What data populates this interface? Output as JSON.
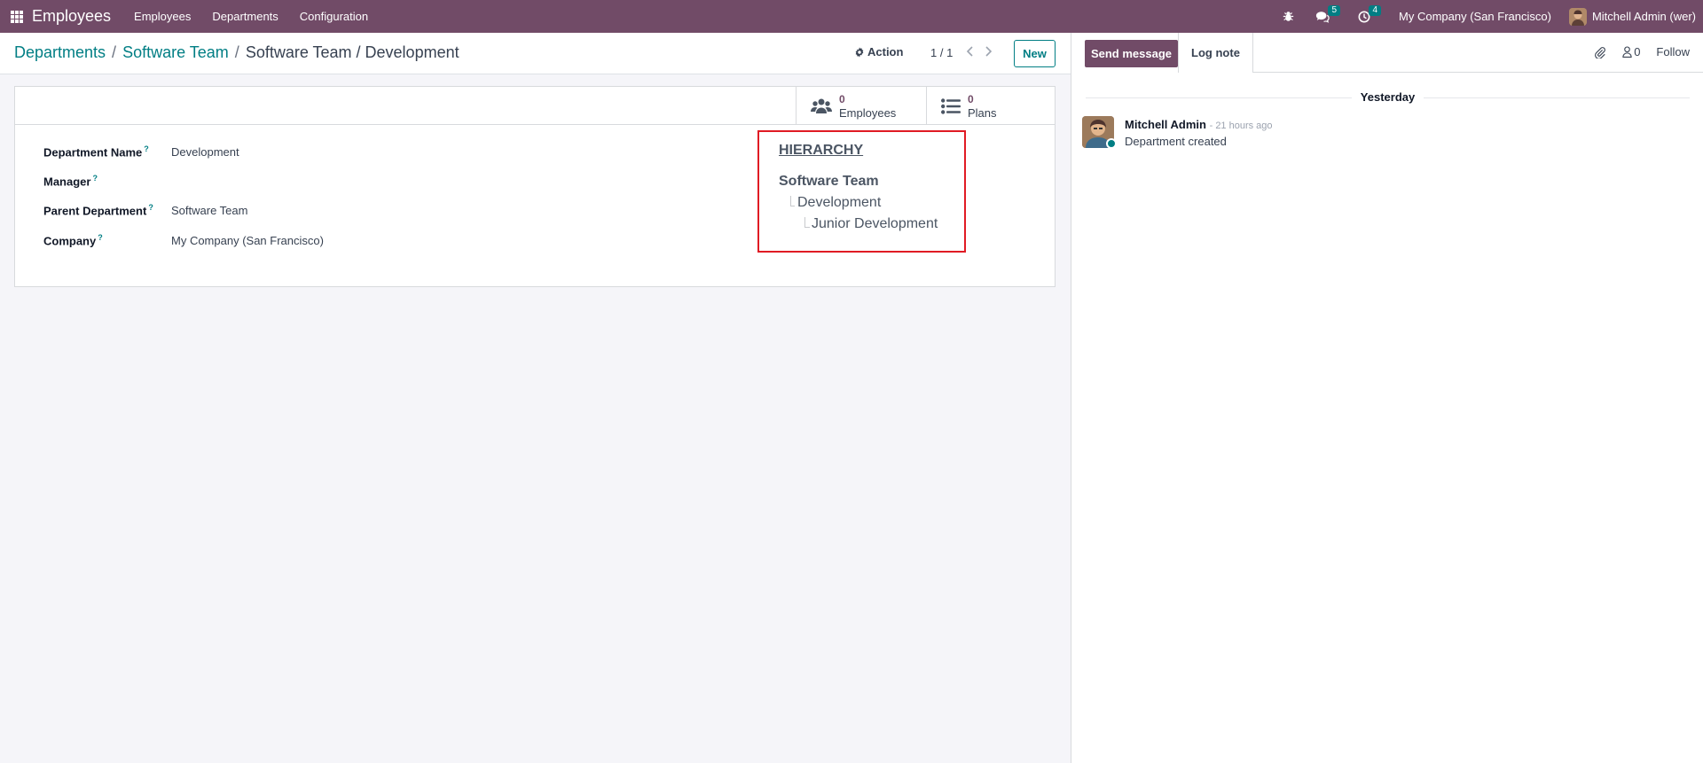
{
  "navbar": {
    "app_name": "Employees",
    "menu": [
      "Employees",
      "Departments",
      "Configuration"
    ],
    "messages_count": "5",
    "activities_count": "4",
    "company": "My Company (San Francisco)",
    "user": "Mitchell Admin (wer)",
    "colors": {
      "brand": "#714B67",
      "accent": "#017e84"
    }
  },
  "breadcrumb": {
    "items": [
      "Departments",
      "Software Team",
      "Software Team / Development"
    ]
  },
  "control": {
    "action_label": "Action",
    "pager": "1 / 1",
    "new_label": "New"
  },
  "stat_buttons": {
    "employees": {
      "value": "0",
      "label": "Employees",
      "icon": "users-icon"
    },
    "plans": {
      "value": "0",
      "label": "Plans",
      "icon": "list-icon"
    }
  },
  "form": {
    "fields": [
      {
        "label": "Department Name",
        "value": "Development"
      },
      {
        "label": "Manager",
        "value": ""
      },
      {
        "label": "Parent Department",
        "value": "Software Team"
      },
      {
        "label": "Company",
        "value": "My Company (San Francisco)"
      }
    ],
    "help_marker": "?"
  },
  "hierarchy": {
    "title": "HIERARCHY",
    "root": "Software Team",
    "level1": "Development",
    "level2": "Junior Development"
  },
  "chatter": {
    "send_message": "Send message",
    "log_note": "Log note",
    "followers_count": "0",
    "follow_label": "Follow",
    "date_separator": "Yesterday",
    "message": {
      "author": "Mitchell Admin",
      "time": "- 21 hours ago",
      "text": "Department created"
    }
  }
}
